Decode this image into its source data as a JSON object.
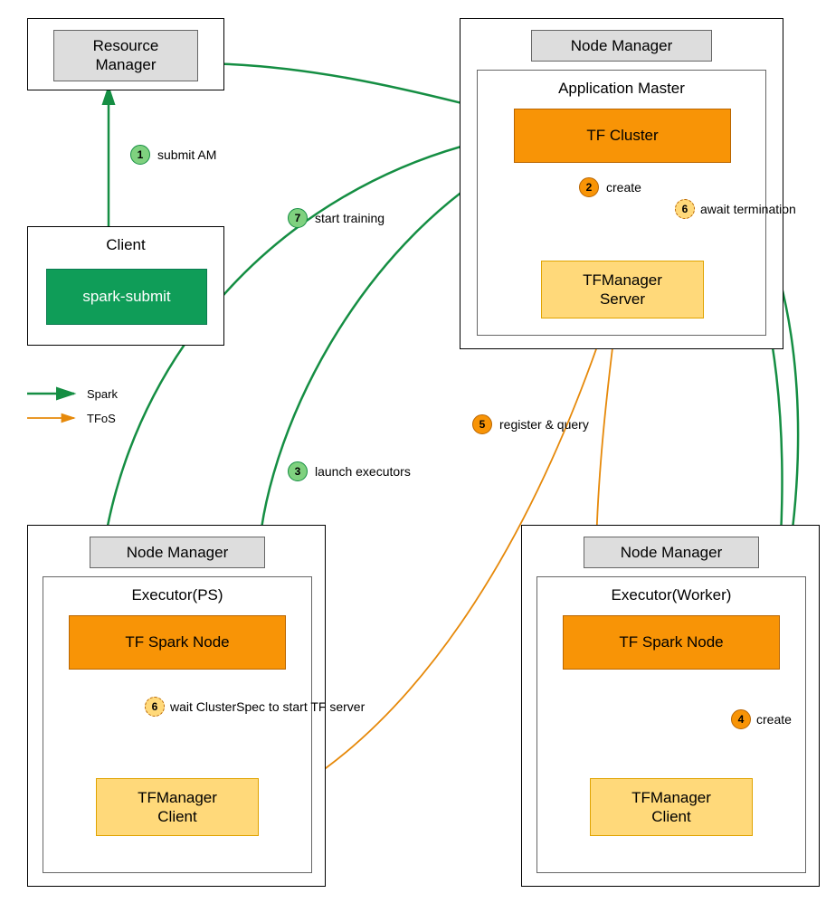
{
  "resource_manager": {
    "label": "Resource\nManager"
  },
  "client": {
    "title": "Client",
    "button": "spark-submit"
  },
  "app_master_container": {
    "badge": "Node Manager",
    "title": "Application Master",
    "tf_cluster": "TF Cluster",
    "tf_server": "TFManager\nServer"
  },
  "executor_ps": {
    "badge": "Node Manager",
    "title": "Executor(PS)",
    "spark_node": "TF Spark Node",
    "client": "TFManager\nClient"
  },
  "executor_worker": {
    "badge": "Node Manager",
    "title": "Executor(Worker)",
    "spark_node": "TF Spark Node",
    "client": "TFManager\nClient"
  },
  "steps": {
    "s1": {
      "n": "1",
      "label": "submit AM"
    },
    "s2": {
      "n": "2",
      "label": "create"
    },
    "s3": {
      "n": "3",
      "label": "launch executors"
    },
    "s4": {
      "n": "4",
      "label": "create"
    },
    "s5": {
      "n": "5",
      "label": "register & query"
    },
    "s6a": {
      "n": "6",
      "label": "await termination"
    },
    "s6b": {
      "n": "6",
      "label": "wait ClusterSpec to start TF server"
    },
    "s7": {
      "n": "7",
      "label": "start training"
    }
  },
  "legend": {
    "spark": "Spark",
    "tfos": "TFoS"
  },
  "colors": {
    "green": "#0f9d58",
    "green_stroke": "#158e43",
    "orange": "#f89406",
    "orange_stroke": "#e6890a"
  }
}
